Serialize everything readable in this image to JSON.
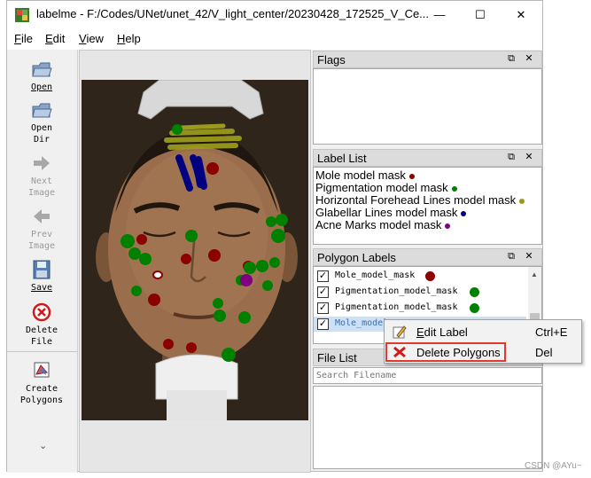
{
  "window": {
    "title": "labelme - F:/Codes/UNet/unet_42/V_light_center/20230428_172525_V_Ce...",
    "minimize": "—",
    "maximize": "☐",
    "close": "✕"
  },
  "menu": {
    "file": {
      "u": "F",
      "rest": "ile"
    },
    "edit": {
      "u": "E",
      "rest": "dit"
    },
    "view": {
      "u": "V",
      "rest": "iew"
    },
    "help": {
      "u": "H",
      "rest": "elp"
    }
  },
  "toolbar": {
    "open": "Open",
    "open_dir": "Open\nDir",
    "next_image": "Next\nImage",
    "prev_image": "Prev\nImage",
    "save": "Save",
    "delete_file": "Delete\nFile",
    "create_polygons": "Create\nPolygons",
    "more": "⌄"
  },
  "docks": {
    "flags": {
      "title": "Flags"
    },
    "label_list": {
      "title": "Label List",
      "items": [
        {
          "text": "Mole model mask",
          "color": "#8b0000"
        },
        {
          "text": "Pigmentation model mask",
          "color": "#008000"
        },
        {
          "text": "Horizontal Forehead Lines model mask",
          "color": "#9a9a1e"
        },
        {
          "text": "Glabellar Lines model mask",
          "color": "#000080"
        },
        {
          "text": "Acne Marks model mask",
          "color": "#800080"
        }
      ]
    },
    "polygon_labels": {
      "title": "Polygon Labels",
      "items": [
        {
          "text": "Mole_model_mask",
          "color": "#8b0000",
          "checked": true
        },
        {
          "text": "Pigmentation_model_mask",
          "color": "#008000",
          "checked": true
        },
        {
          "text": "Pigmentation_model_mask",
          "color": "#008000",
          "checked": true
        },
        {
          "text": "Mole_model",
          "color": "#8b0000",
          "checked": true
        }
      ]
    },
    "file_list": {
      "title": "File List",
      "search_placeholder": "Search Filename"
    },
    "float_glyph": "⧉",
    "close_glyph": "✕"
  },
  "context_menu": {
    "edit_label": {
      "label_u": "E",
      "label_rest": "dit Label",
      "shortcut": "Ctrl+E"
    },
    "delete_polygons": {
      "label": "Delete Polygons",
      "shortcut": "Del"
    }
  },
  "watermark": "CSDN @AYu~",
  "colors": {
    "mole": "#8b0000",
    "pigmentation": "#008000",
    "forehead_lines": "#9a9a1e",
    "glabellar_lines": "#000080",
    "acne_marks": "#800080",
    "selection": "#cde0f5",
    "highlight_box": "#e0392f"
  }
}
